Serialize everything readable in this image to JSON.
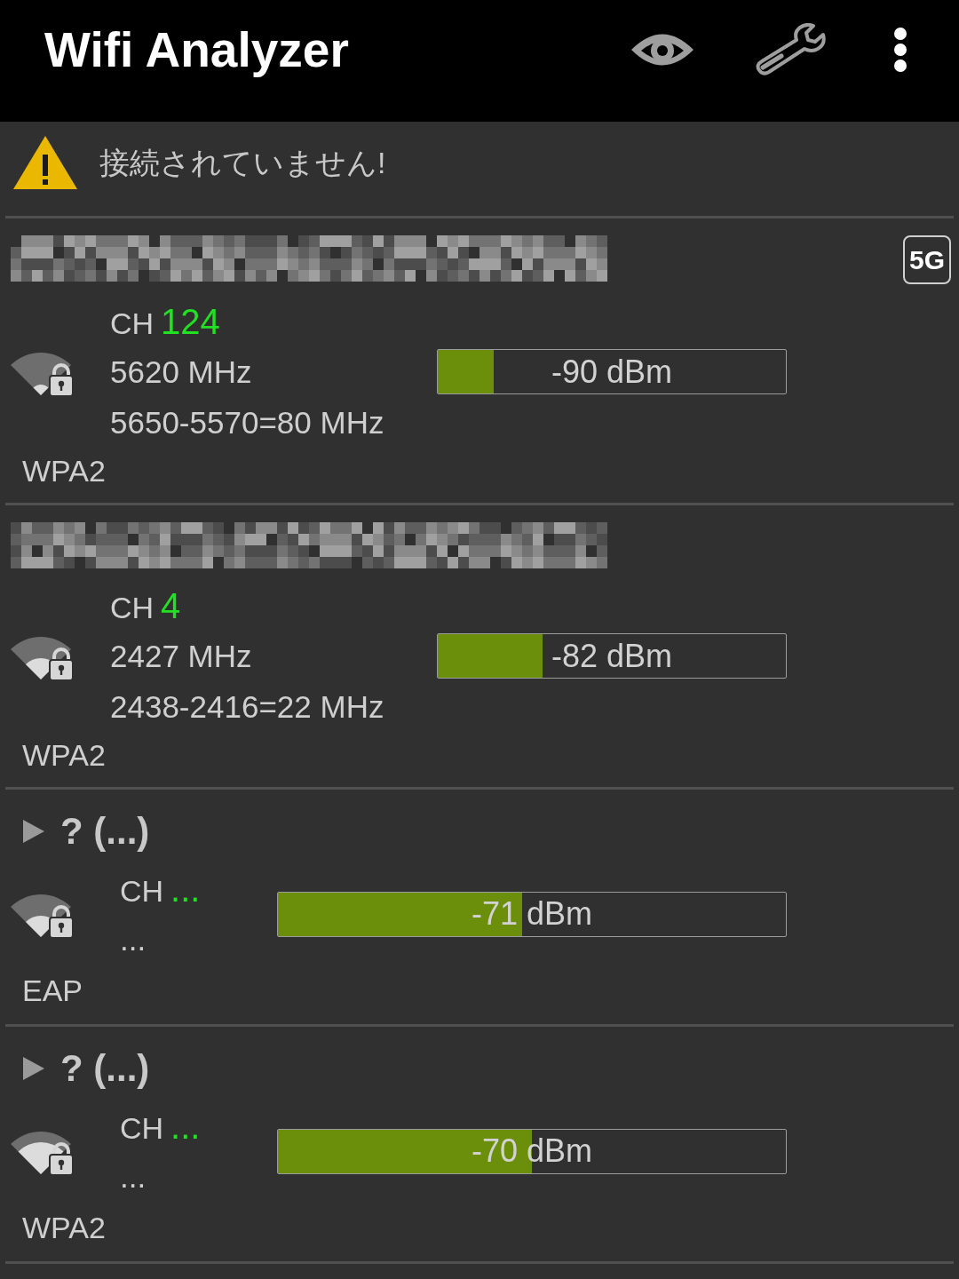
{
  "app_bar": {
    "title": "Wifi Analyzer"
  },
  "warning": {
    "message": "接続されていません!"
  },
  "networks": [
    {
      "kind": "network",
      "badge": "5G",
      "channel_label": "CH",
      "channel": "124",
      "frequency": "5620 MHz",
      "range": "5650-5570=80 MHz",
      "security": "WPA2",
      "signal": {
        "level": 0.16,
        "reading": "-90 dBm"
      }
    },
    {
      "kind": "network",
      "channel_label": "CH",
      "channel": "4",
      "frequency": "2427 MHz",
      "range": "2438-2416=22 MHz",
      "security": "WPA2",
      "signal": {
        "level": 0.3,
        "reading": "-82 dBm"
      }
    },
    {
      "kind": "group",
      "expanded": false,
      "title": "? (...)",
      "channel_label": "CH",
      "channel": "...",
      "frequency": "...",
      "security": "EAP",
      "signal": {
        "level": 0.48,
        "reading": "-71 dBm"
      }
    },
    {
      "kind": "group",
      "expanded": false,
      "title": "? (...)",
      "channel_label": "CH",
      "channel": "...",
      "frequency": "...",
      "security": "WPA2",
      "signal": {
        "level": 0.5,
        "reading": "-70 dBm"
      }
    }
  ]
}
